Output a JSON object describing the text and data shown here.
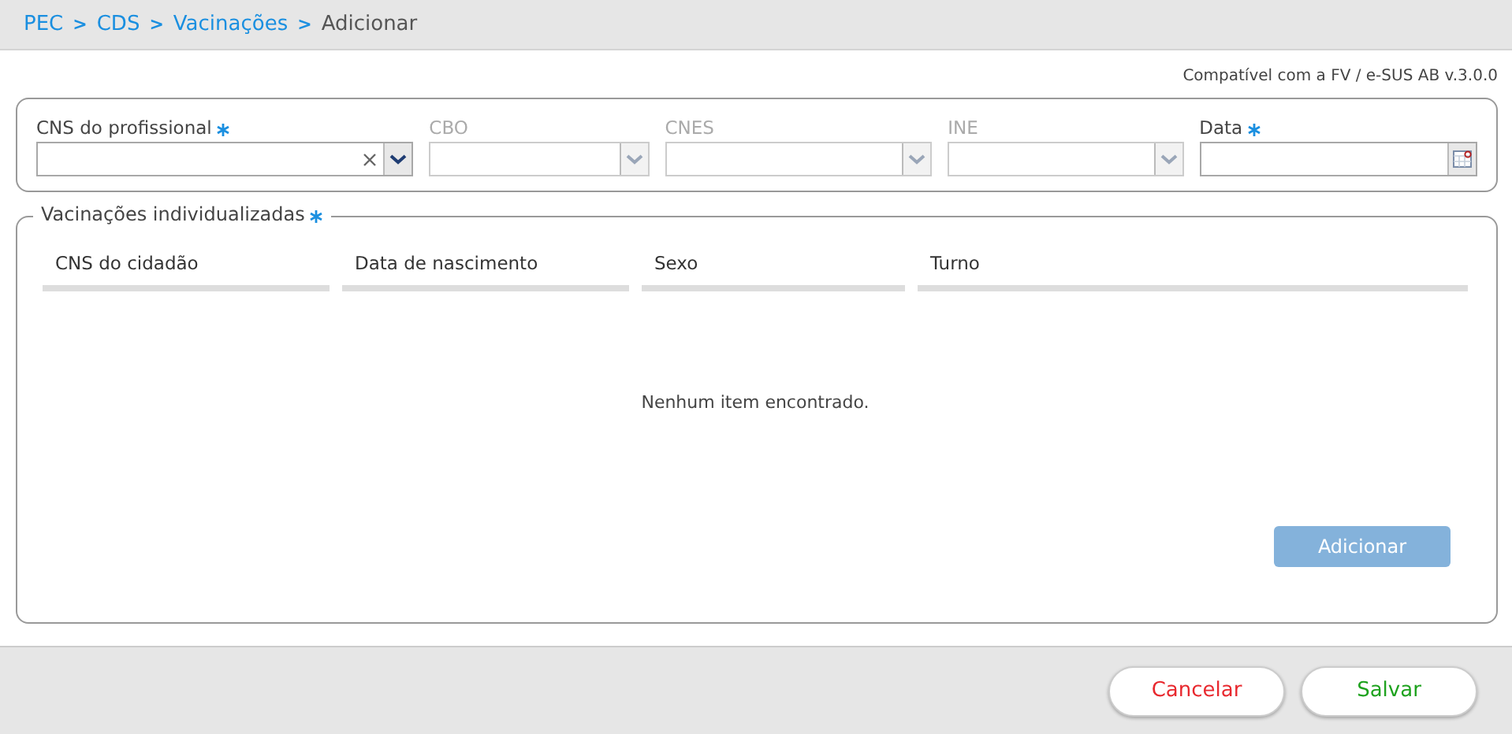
{
  "breadcrumb": [
    {
      "label": "PEC",
      "link": true
    },
    {
      "separator": ">",
      "label": "CDS",
      "link": true
    },
    {
      "separator": ">",
      "label": "Vacinações",
      "link": true
    },
    {
      "separator": ">",
      "label": "Adicionar",
      "link": false
    }
  ],
  "version_note": "Compatível com a FV / e-SUS AB v.3.0.0",
  "fields": [
    {
      "label": "CNS do profissional",
      "kind": "combo",
      "required": true,
      "disabled": false,
      "clearable": true
    },
    {
      "label": "CBO",
      "kind": "combo",
      "required": false,
      "disabled": true,
      "clearable": false
    },
    {
      "label": "CNES",
      "kind": "combo",
      "required": false,
      "disabled": true,
      "clearable": false
    },
    {
      "label": "INE",
      "kind": "combo",
      "required": false,
      "disabled": true,
      "clearable": false
    },
    {
      "label": "Data",
      "kind": "date",
      "required": true,
      "disabled": false,
      "clearable": false
    }
  ],
  "vaccinations": {
    "legend": "Vacinações individualizadas",
    "required": true,
    "columns": [
      "CNS do cidadão",
      "Data de nascimento",
      "Sexo",
      "Turno"
    ],
    "empty_message": "Nenhum item encontrado.",
    "add_button": {
      "label": "Adicionar",
      "disabled": true
    }
  },
  "footer_buttons": [
    {
      "label": "Cancelar",
      "kind": "cancel"
    },
    {
      "label": "Salvar",
      "kind": "save"
    }
  ]
}
